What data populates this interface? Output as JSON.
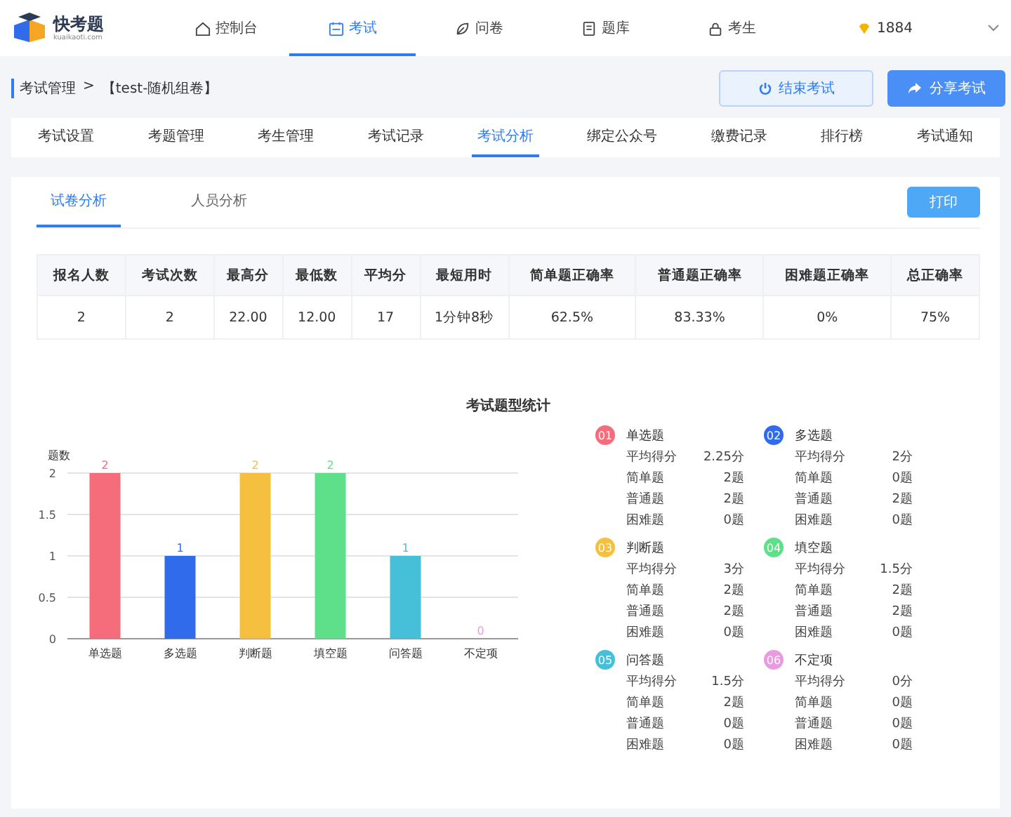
{
  "brand": {
    "name": "快考题",
    "domain": "kuaikaoti.com"
  },
  "nav": [
    {
      "label": "控制台",
      "selected": false
    },
    {
      "label": "考试",
      "selected": true
    },
    {
      "label": "问卷",
      "selected": false
    },
    {
      "label": "题库",
      "selected": false
    },
    {
      "label": "考生",
      "selected": false
    }
  ],
  "user": {
    "name": "1884"
  },
  "breadcrumb": {
    "parent": "考试管理",
    "separator": ">",
    "current": "【test-随机组卷】"
  },
  "actions": [
    {
      "label": "结束考试",
      "kind": "end"
    },
    {
      "label": "分享考试",
      "kind": "share"
    }
  ],
  "tabs": [
    {
      "label": "考试设置",
      "selected": false
    },
    {
      "label": "考题管理",
      "selected": false
    },
    {
      "label": "考生管理",
      "selected": false
    },
    {
      "label": "考试记录",
      "selected": false
    },
    {
      "label": "考试分析",
      "selected": true
    },
    {
      "label": "绑定公众号",
      "selected": false
    },
    {
      "label": "缴费记录",
      "selected": false
    },
    {
      "label": "排行榜",
      "selected": false
    },
    {
      "label": "考试通知",
      "selected": false
    }
  ],
  "subtabs": [
    {
      "label": "试卷分析",
      "selected": true
    },
    {
      "label": "人员分析",
      "selected": false
    }
  ],
  "print_button": "打印",
  "table": {
    "columns": [
      "报名人数",
      "考试次数",
      "最高分",
      "最低数",
      "平均分",
      "最短用时",
      "简单题正确率",
      "普通题正确率",
      "困难题正确率",
      "总正确率"
    ],
    "rows": [
      [
        "2",
        "2",
        "22.00",
        "12.00",
        "17",
        "1分钟8秒",
        "62.5%",
        "83.33%",
        "0%",
        "75%"
      ]
    ]
  },
  "chart_title": "考试题型统计",
  "chart_data": {
    "type": "bar",
    "ylabel": "题数",
    "categories": [
      "单选题",
      "多选题",
      "判断题",
      "填空题",
      "问答题",
      "不定项"
    ],
    "values": [
      2,
      1,
      2,
      2,
      1,
      0
    ],
    "ylim": [
      0,
      2
    ],
    "grid": true,
    "yticks": [
      0,
      {
        "value": 0.5,
        "label": "0.5"
      },
      1,
      {
        "value": 1.5,
        "label": "1.5"
      },
      2
    ],
    "data_labels": true
  },
  "stats": [
    {
      "num": "01",
      "title": "单选题",
      "color": "#f56c7a",
      "rows": [
        [
          "平均得分",
          "2.25分"
        ],
        [
          "简单题",
          "2题"
        ],
        [
          "普通题",
          "2题"
        ],
        [
          "困难题",
          "0题"
        ]
      ]
    },
    {
      "num": "02",
      "title": "多选题",
      "color": "#2f6bea",
      "rows": [
        [
          "平均得分",
          "2分"
        ],
        [
          "简单题",
          "0题"
        ],
        [
          "普通题",
          "2题"
        ],
        [
          "困难题",
          "0题"
        ]
      ]
    },
    {
      "num": "03",
      "title": "判断题",
      "color": "#f5c040",
      "rows": [
        [
          "平均得分",
          "3分"
        ],
        [
          "简单题",
          "2题"
        ],
        [
          "普通题",
          "2题"
        ],
        [
          "困难题",
          "0题"
        ]
      ]
    },
    {
      "num": "04",
      "title": "填空题",
      "color": "#5ee08a",
      "rows": [
        [
          "平均得分",
          "1.5分"
        ],
        [
          "简单题",
          "2题"
        ],
        [
          "普通题",
          "2题"
        ],
        [
          "困难题",
          "0题"
        ]
      ]
    },
    {
      "num": "05",
      "title": "问答题",
      "color": "#45c0d8",
      "rows": [
        [
          "平均得分",
          "1.5分"
        ],
        [
          "简单题",
          "2题"
        ],
        [
          "普通题",
          "0题"
        ],
        [
          "困难题",
          "0题"
        ]
      ]
    },
    {
      "num": "06",
      "title": "不定项",
      "color": "#e99be0",
      "rows": [
        [
          "平均得分",
          "0分"
        ],
        [
          "简单题",
          "0题"
        ],
        [
          "普通题",
          "0题"
        ],
        [
          "困难题",
          "0题"
        ]
      ]
    }
  ]
}
